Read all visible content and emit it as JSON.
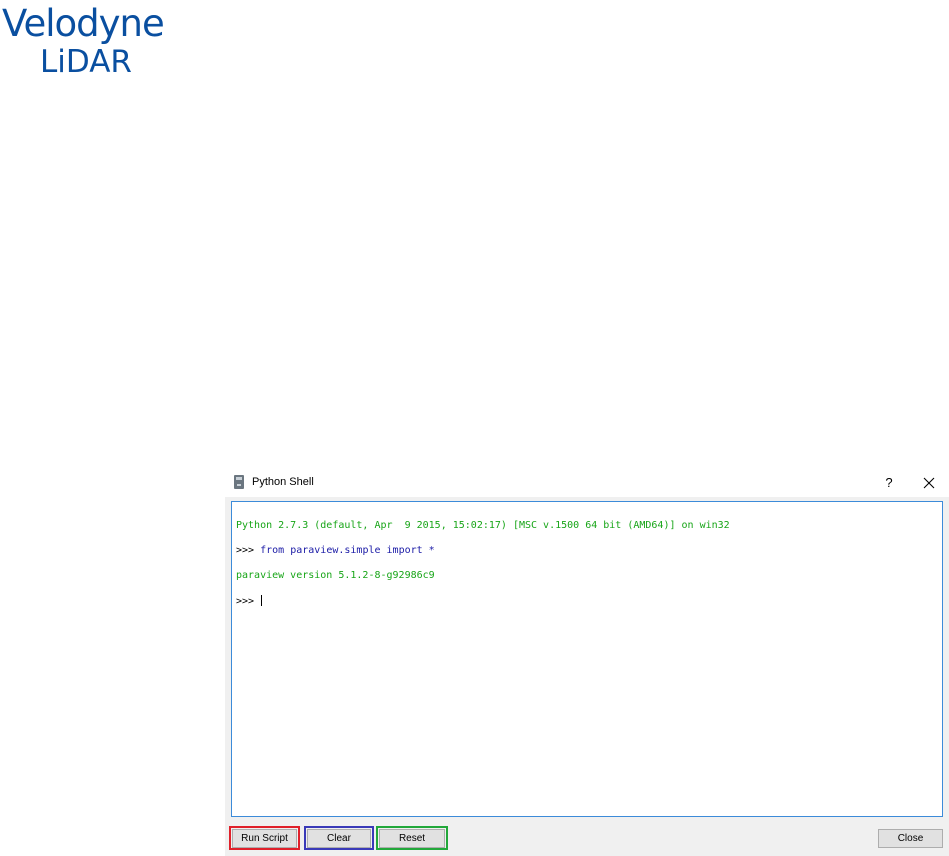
{
  "logo": {
    "line1": "Velodyne",
    "line2": "LiDAR"
  },
  "window": {
    "title": "Python Shell",
    "help_label": "?",
    "close_icon": "close-icon",
    "app_icon": "python-shell-icon"
  },
  "console": {
    "lines": [
      {
        "text": "Python 2.7.3 (default, Apr  9 2015, 15:02:17) [MSC v.1500 64 bit (AMD64)] on win32",
        "kind": "output"
      },
      {
        "prompt": ">>> ",
        "text": "from paraview.simple import *",
        "kind": "command"
      },
      {
        "text": "paraview version 5.1.2-8-g92986c9",
        "kind": "output"
      },
      {
        "prompt": ">>> ",
        "text": "",
        "kind": "input"
      }
    ]
  },
  "buttons": {
    "run_script": "Run Script",
    "clear": "Clear",
    "reset": "Reset",
    "close": "Close"
  },
  "colors": {
    "logo": "#0a4fa0",
    "output_text": "#17a517",
    "command_text": "#1a1aa6",
    "focus_border": "#3c8bd9",
    "highlight_run_script": "#e0202a",
    "highlight_clear": "#3a3ab8",
    "highlight_reset": "#22a83a"
  }
}
